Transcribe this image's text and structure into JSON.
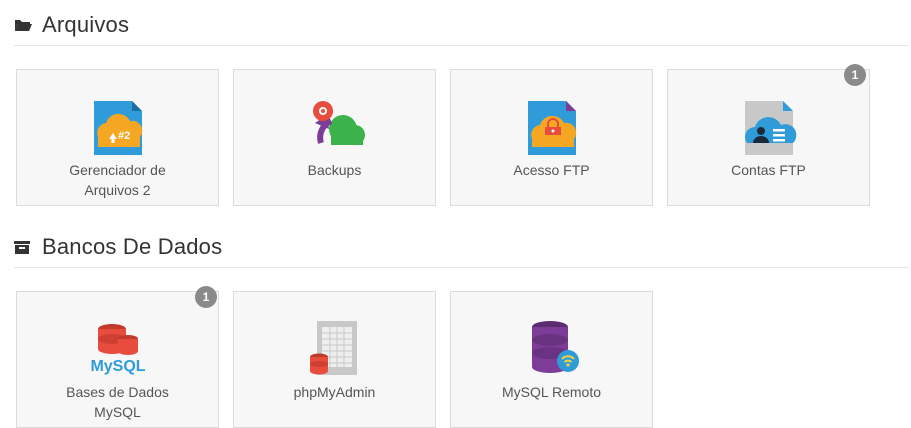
{
  "sections": [
    {
      "title": "Arquivos",
      "icon": "folder-open-icon",
      "tiles": [
        {
          "label_line1": "Gerenciador de",
          "label_line2": "Arquivos 2",
          "icon": "file-manager-icon"
        },
        {
          "label_line1": "Backups",
          "label_line2": "",
          "icon": "backup-icon"
        },
        {
          "label_line1": "Acesso FTP",
          "label_line2": "",
          "icon": "ftp-access-icon"
        },
        {
          "label_line1": "Contas FTP",
          "label_line2": "",
          "icon": "ftp-accounts-icon",
          "badge": "1"
        }
      ]
    },
    {
      "title": "Bancos De Dados",
      "icon": "archive-icon",
      "tiles": [
        {
          "label_line1": "Bases de Dados",
          "label_line2": "MySQL",
          "icon": "mysql-databases-icon",
          "badge": "1"
        },
        {
          "label_line1": "phpMyAdmin",
          "label_line2": "",
          "icon": "phpmyadmin-icon"
        },
        {
          "label_line1": "MySQL Remoto",
          "label_line2": "",
          "icon": "remote-mysql-icon"
        }
      ]
    }
  ],
  "colors": {
    "tile_bg": "#f7f7f7",
    "tile_border": "#dcdcdc",
    "badge_bg": "#8a8a8a",
    "orange": "#f5a623",
    "blue": "#2f9bd8",
    "red": "#e74c3c",
    "purple": "#7d3c98",
    "green": "#3cb24a"
  }
}
